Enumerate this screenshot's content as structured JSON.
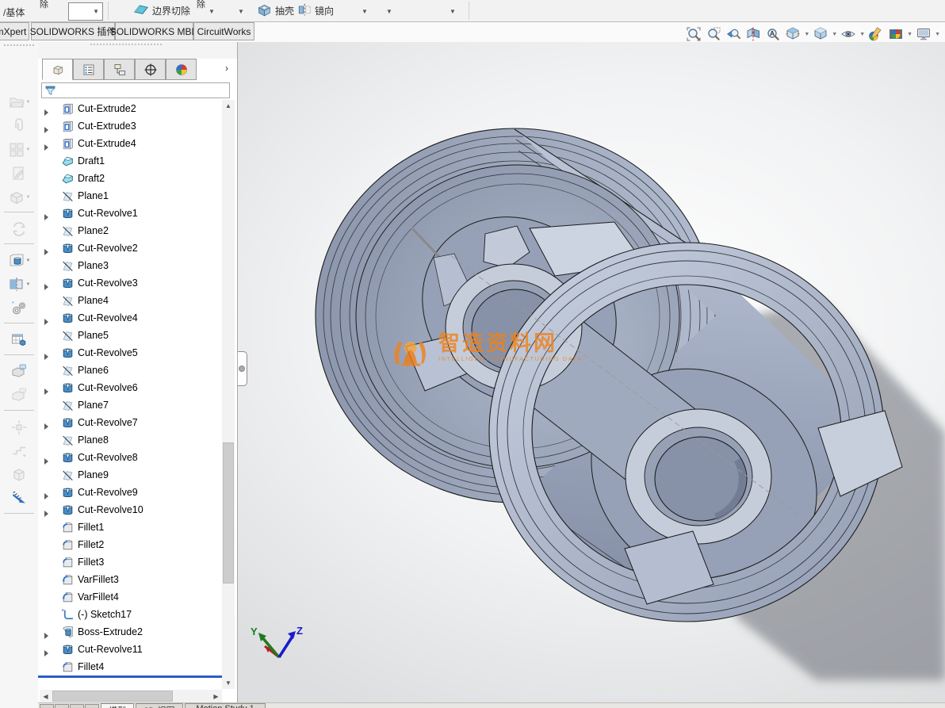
{
  "colors": {
    "accent_blue": "#2a5cc8",
    "model_base": "#9fa9bf",
    "watermark_orange": "#f08119",
    "viewport_bg": "#eceded"
  },
  "ribbon": {
    "fragment_left": "/基体",
    "fragment_cut1": "除",
    "fragment_cut2": "除",
    "boundary_cut_label": "边界切除",
    "shell_label": "抽壳",
    "mirror_label": "镜向"
  },
  "command_tabs": [
    {
      "label": "mXpert"
    },
    {
      "label": "SOLIDWORKS 插件"
    },
    {
      "label": "SOLIDWORKS MBD"
    },
    {
      "label": "CircuitWorks"
    }
  ],
  "headsup_toolbar": [
    {
      "icon": "zoom-to-fit",
      "dropdown": false
    },
    {
      "icon": "zoom-to-area",
      "dropdown": false
    },
    {
      "icon": "previous-view",
      "dropdown": false
    },
    {
      "icon": "section-view",
      "dropdown": false
    },
    {
      "icon": "dynamic-annotation-views",
      "dropdown": false
    },
    {
      "icon": "view-orientation",
      "dropdown": true
    },
    {
      "icon": "display-style",
      "dropdown": true
    },
    {
      "icon": "hide-show-items",
      "dropdown": true
    },
    {
      "icon": "edit-appearance",
      "dropdown": false
    },
    {
      "icon": "apply-scene",
      "dropdown": true
    },
    {
      "icon": "view-settings",
      "dropdown": true
    }
  ],
  "left_toolbar": [
    {
      "icon": "open-part",
      "dropdown": true,
      "enabled": false
    },
    {
      "icon": "attachment",
      "dropdown": false,
      "enabled": false
    },
    {
      "icon": "derived-parts",
      "dropdown": true,
      "enabled": false
    },
    {
      "icon": "edit-document",
      "dropdown": false,
      "enabled": false
    },
    {
      "icon": "insert-component",
      "dropdown": true,
      "enabled": false
    },
    {
      "sep": true
    },
    {
      "icon": "replace-model",
      "dropdown": false,
      "enabled": false
    },
    {
      "sep": true
    },
    {
      "icon": "boss-extrude-tool",
      "dropdown": true,
      "enabled": true
    },
    {
      "icon": "section-tool",
      "dropdown": true,
      "enabled": true
    },
    {
      "icon": "gear-settings",
      "dropdown": false,
      "enabled": true
    },
    {
      "sep": true
    },
    {
      "icon": "design-table",
      "dropdown": false,
      "enabled": true
    },
    {
      "sep": true
    },
    {
      "icon": "comment",
      "dropdown": false,
      "enabled": true
    },
    {
      "icon": "comment-alt",
      "dropdown": false,
      "enabled": false
    },
    {
      "sep": true
    },
    {
      "icon": "exploded-view",
      "dropdown": false,
      "enabled": false
    },
    {
      "icon": "flatten",
      "dropdown": false,
      "enabled": false
    },
    {
      "icon": "structure",
      "dropdown": false,
      "enabled": false
    },
    {
      "icon": "measure-tool",
      "dropdown": false,
      "enabled": true
    },
    {
      "sep": true
    }
  ],
  "feature_manager": {
    "tabs": [
      {
        "icon": "features-tree",
        "active": true
      },
      {
        "icon": "property-manager",
        "active": false
      },
      {
        "icon": "configuration-manager",
        "active": false
      },
      {
        "icon": "dimxpert-manager",
        "active": false
      },
      {
        "icon": "display-manager",
        "active": false
      }
    ],
    "overflow_glyph": "›",
    "filter_value": "",
    "items": [
      {
        "label": "Cut-Extrude2",
        "icon": "cut-extrude",
        "expandable": true
      },
      {
        "label": "Cut-Extrude3",
        "icon": "cut-extrude",
        "expandable": true
      },
      {
        "label": "Cut-Extrude4",
        "icon": "cut-extrude",
        "expandable": true
      },
      {
        "label": "Draft1",
        "icon": "draft",
        "expandable": false
      },
      {
        "label": "Draft2",
        "icon": "draft",
        "expandable": false
      },
      {
        "label": "Plane1",
        "icon": "plane",
        "expandable": false
      },
      {
        "label": "Cut-Revolve1",
        "icon": "cut-revolve",
        "expandable": true
      },
      {
        "label": "Plane2",
        "icon": "plane",
        "expandable": false
      },
      {
        "label": "Cut-Revolve2",
        "icon": "cut-revolve",
        "expandable": true
      },
      {
        "label": "Plane3",
        "icon": "plane",
        "expandable": false
      },
      {
        "label": "Cut-Revolve3",
        "icon": "cut-revolve",
        "expandable": true
      },
      {
        "label": "Plane4",
        "icon": "plane",
        "expandable": false
      },
      {
        "label": "Cut-Revolve4",
        "icon": "cut-revolve",
        "expandable": true
      },
      {
        "label": "Plane5",
        "icon": "plane",
        "expandable": false
      },
      {
        "label": "Cut-Revolve5",
        "icon": "cut-revolve",
        "expandable": true
      },
      {
        "label": "Plane6",
        "icon": "plane",
        "expandable": false
      },
      {
        "label": "Cut-Revolve6",
        "icon": "cut-revolve",
        "expandable": true
      },
      {
        "label": "Plane7",
        "icon": "plane",
        "expandable": false
      },
      {
        "label": "Cut-Revolve7",
        "icon": "cut-revolve",
        "expandable": true
      },
      {
        "label": "Plane8",
        "icon": "plane",
        "expandable": false
      },
      {
        "label": "Cut-Revolve8",
        "icon": "cut-revolve",
        "expandable": true
      },
      {
        "label": "Plane9",
        "icon": "plane",
        "expandable": false
      },
      {
        "label": "Cut-Revolve9",
        "icon": "cut-revolve",
        "expandable": true
      },
      {
        "label": "Cut-Revolve10",
        "icon": "cut-revolve",
        "expandable": true
      },
      {
        "label": "Fillet1",
        "icon": "fillet",
        "expandable": false
      },
      {
        "label": "Fillet2",
        "icon": "fillet",
        "expandable": false
      },
      {
        "label": "Fillet3",
        "icon": "fillet",
        "expandable": false
      },
      {
        "label": "VarFillet3",
        "icon": "var-fillet",
        "expandable": false
      },
      {
        "label": "VarFillet4",
        "icon": "var-fillet",
        "expandable": false
      },
      {
        "label": "(-) Sketch17",
        "icon": "sketch",
        "expandable": false
      },
      {
        "label": "Boss-Extrude2",
        "icon": "boss-extrude",
        "expandable": true
      },
      {
        "label": "Cut-Revolve11",
        "icon": "cut-revolve",
        "expandable": true
      },
      {
        "label": "Fillet4",
        "icon": "fillet",
        "expandable": false
      }
    ]
  },
  "viewport": {
    "watermark": {
      "title": "智造资料网",
      "subtitle": "INTELLIGENT MANUFACTURING DATA"
    },
    "triad": {
      "y_label": "Y",
      "z_label": "Z"
    }
  },
  "bottom_bar": {
    "buttons": [
      "pane-button-1",
      "pane-button-2",
      "pane-button-3",
      "pane-button-4"
    ],
    "tabs": [
      {
        "label": "模型",
        "active": true
      },
      {
        "label": "3D 视图",
        "active": false
      },
      {
        "label": "Motion Study 1",
        "active": false
      }
    ]
  }
}
